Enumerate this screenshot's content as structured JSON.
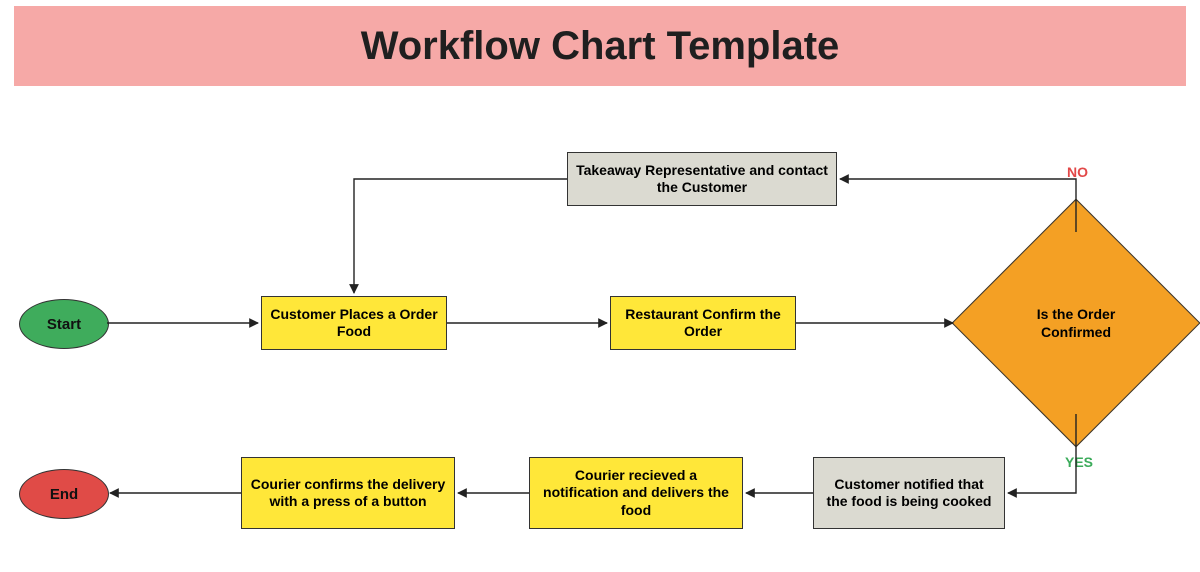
{
  "title": "Workflow Chart Template",
  "colors": {
    "titleBg": "#f6a9a7",
    "startBg": "#3fac5c",
    "endBg": "#e04b47",
    "processYellow": "#ffe739",
    "processGray": "#dbdad1",
    "decisionBg": "#f4a024",
    "noLabel": "#e24848",
    "yesLabel": "#3bab5a",
    "stroke": "#222222"
  },
  "nodes": {
    "start": "Start",
    "end": "End",
    "placeOrder": "Customer Places a Order Food",
    "restaurantConfirm": "Restaurant Confirm the Order",
    "decision": "Is the Order Confirmed",
    "noBranch": "Takeaway Representative and contact the Customer",
    "notifyCooking": "Customer notified that the food is being cooked",
    "courierReceive": "Courier recieved a notification and delivers the food",
    "courierConfirm": "Courier confirms the delivery with a press of a button"
  },
  "branchLabels": {
    "no": "NO",
    "yes": "YES"
  },
  "chart_data": {
    "type": "flowchart",
    "title": "Workflow Chart Template",
    "nodes": [
      {
        "id": "start",
        "shape": "terminator",
        "fill": "green",
        "label": "Start"
      },
      {
        "id": "place",
        "shape": "process",
        "fill": "yellow",
        "label": "Customer Places a Order Food"
      },
      {
        "id": "rconf",
        "shape": "process",
        "fill": "yellow",
        "label": "Restaurant Confirm the Order"
      },
      {
        "id": "dec",
        "shape": "decision",
        "fill": "orange",
        "label": "Is the Order Confirmed"
      },
      {
        "id": "noRep",
        "shape": "process",
        "fill": "gray",
        "label": "Takeaway Representative and contact the Customer"
      },
      {
        "id": "cook",
        "shape": "process",
        "fill": "gray",
        "label": "Customer notified that the food is being cooked"
      },
      {
        "id": "crecv",
        "shape": "process",
        "fill": "yellow",
        "label": "Courier recieved a notification and delivers the food"
      },
      {
        "id": "cconf",
        "shape": "process",
        "fill": "yellow",
        "label": "Courier confirms the delivery with a press of a button"
      },
      {
        "id": "end",
        "shape": "terminator",
        "fill": "red",
        "label": "End"
      }
    ],
    "edges": [
      {
        "from": "start",
        "to": "place"
      },
      {
        "from": "place",
        "to": "rconf"
      },
      {
        "from": "rconf",
        "to": "dec"
      },
      {
        "from": "dec",
        "to": "noRep",
        "label": "NO"
      },
      {
        "from": "noRep",
        "to": "place"
      },
      {
        "from": "dec",
        "to": "cook",
        "label": "YES"
      },
      {
        "from": "cook",
        "to": "crecv"
      },
      {
        "from": "crecv",
        "to": "cconf"
      },
      {
        "from": "cconf",
        "to": "end"
      }
    ]
  }
}
